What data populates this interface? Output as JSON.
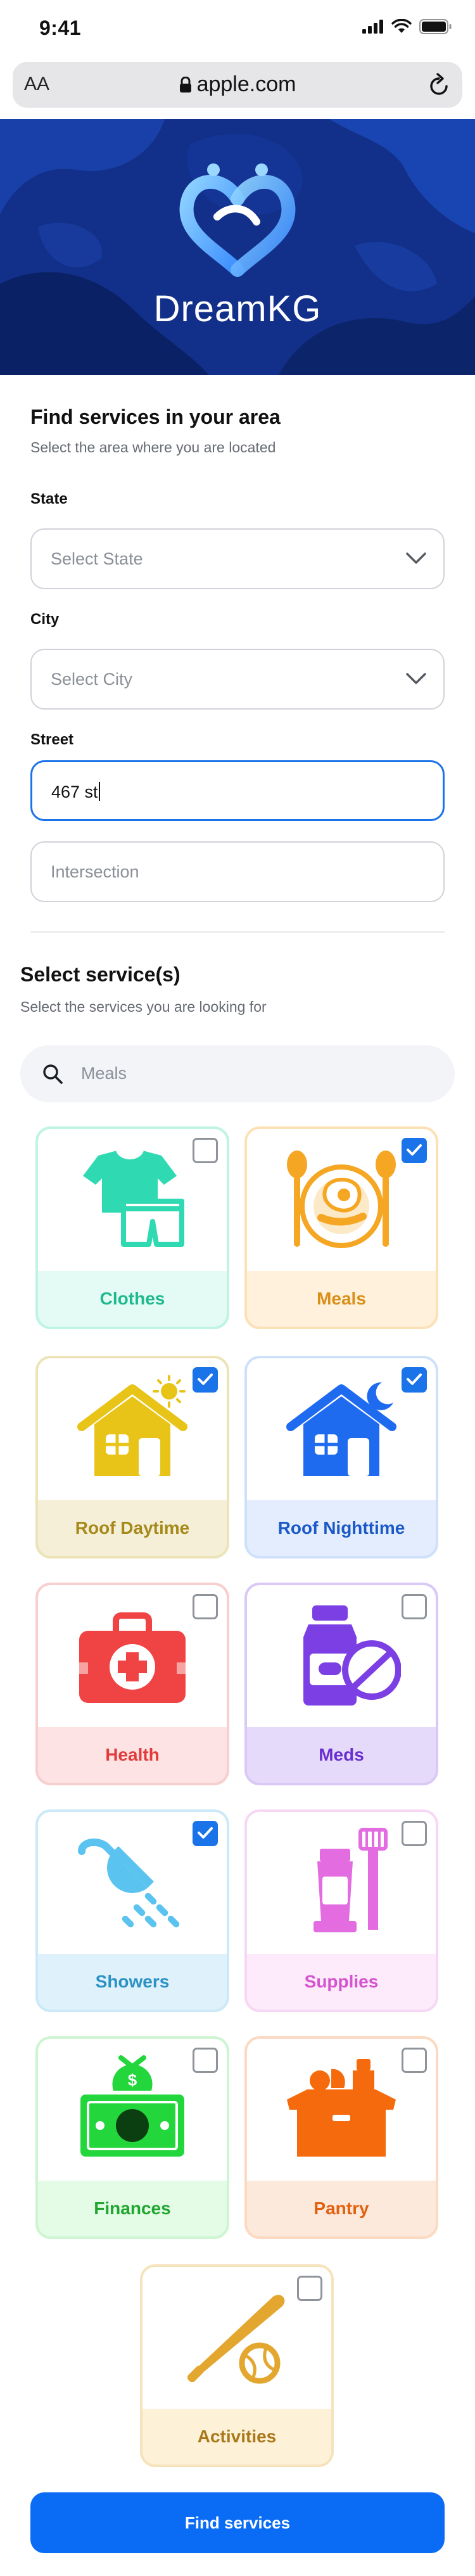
{
  "status_bar": {
    "time": "9:41"
  },
  "browser": {
    "text_size_label": "AA",
    "url": "apple.com"
  },
  "brand": {
    "name": "DreamKG"
  },
  "area_section": {
    "title": "Find services in your area",
    "subtitle": "Select the area where you are located",
    "state_label": "State",
    "state_placeholder": "Select State",
    "city_label": "City",
    "city_placeholder": "Select City",
    "street_label": "Street",
    "street_value": "467 st",
    "intersection_placeholder": "Intersection"
  },
  "services_section": {
    "title": "Select service(s)",
    "subtitle": "Select the services you are looking for",
    "search_placeholder": "Meals",
    "cards": [
      {
        "label": "Clothes",
        "checked": false,
        "icon": "clothes-icon",
        "color": "#2fd9b1"
      },
      {
        "label": "Meals",
        "checked": true,
        "icon": "meals-icon",
        "color": "#f5a623"
      },
      {
        "label": "Roof Daytime",
        "checked": true,
        "icon": "house-sun-icon",
        "color": "#e8c419"
      },
      {
        "label": "Roof Nighttime",
        "checked": true,
        "icon": "house-moon-icon",
        "color": "#1e6bf0"
      },
      {
        "label": "Health",
        "checked": false,
        "icon": "first-aid-kit-icon",
        "color": "#f04444"
      },
      {
        "label": "Meds",
        "checked": false,
        "icon": "medicine-icon",
        "color": "#7b3fe4"
      },
      {
        "label": "Showers",
        "checked": true,
        "icon": "shower-icon",
        "color": "#5bc3ef"
      },
      {
        "label": "Supplies",
        "checked": false,
        "icon": "toothpaste-icon",
        "color": "#e36ce0"
      },
      {
        "label": "Finances",
        "checked": false,
        "icon": "money-icon",
        "color": "#22d63b"
      },
      {
        "label": "Pantry",
        "checked": false,
        "icon": "pantry-box-icon",
        "color": "#f56a0c"
      },
      {
        "label": "Activities",
        "checked": false,
        "icon": "baseball-icon",
        "color": "#e3a72f"
      }
    ]
  },
  "cta": {
    "label": "Find services"
  },
  "colors": {
    "accent": "#0a6cf5",
    "focus": "#1a73e8",
    "banner": "#0f2a78"
  }
}
